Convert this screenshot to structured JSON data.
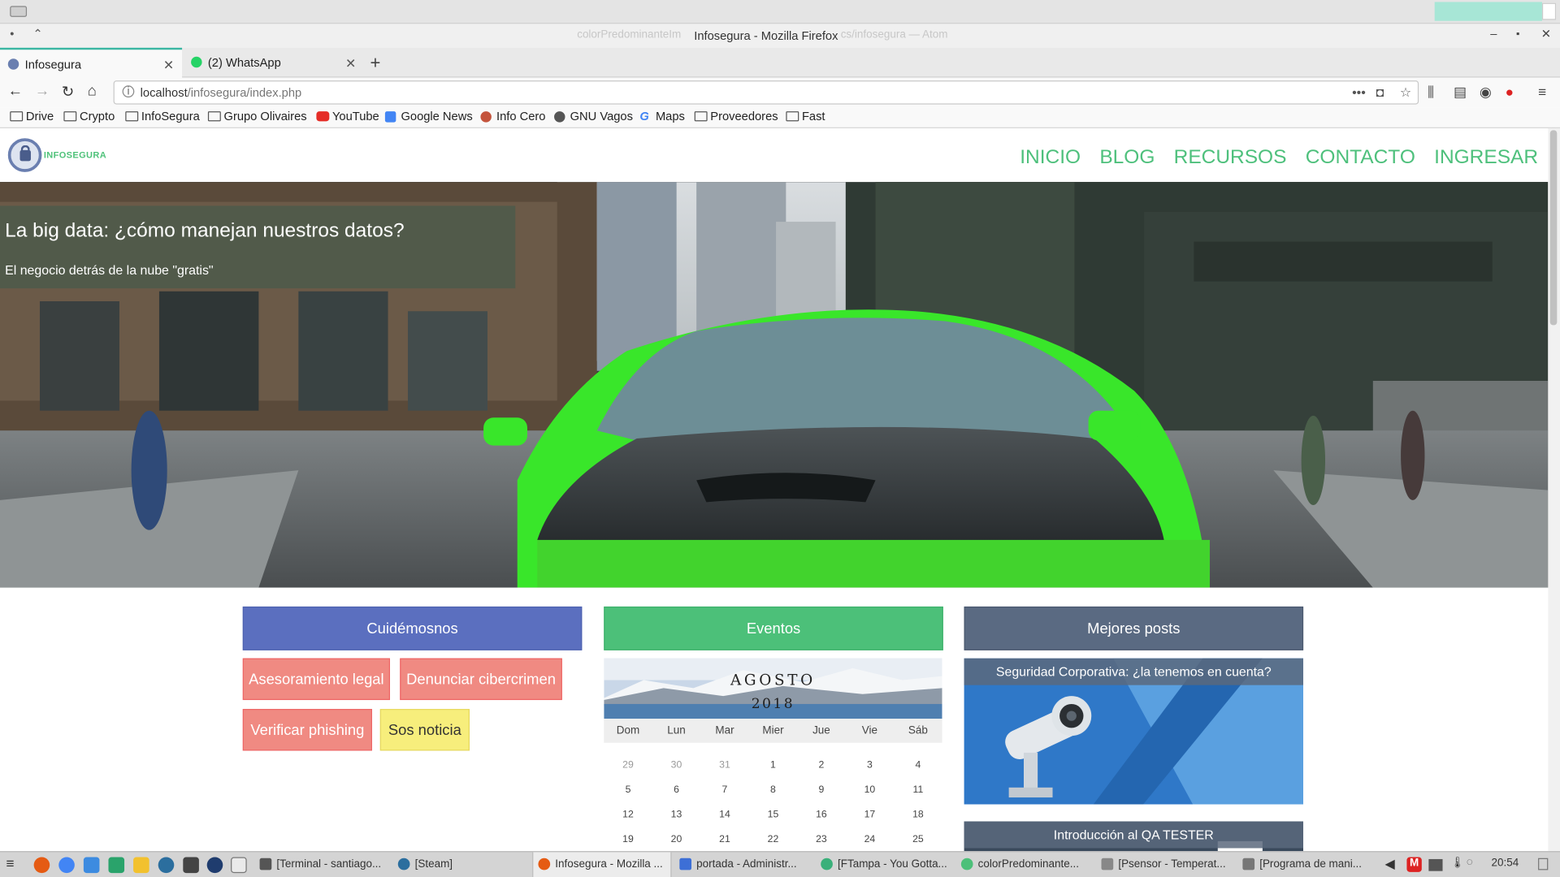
{
  "window": {
    "title": "Infosegura - Mozilla Firefox",
    "ghost_left": "colorPredominanteIm",
    "ghost_right": "cs/infosegura — Atom"
  },
  "tabs": [
    {
      "label": "Infosegura"
    },
    {
      "label": "(2) WhatsApp"
    }
  ],
  "url": {
    "host": "localhost",
    "path": "/infosegura/index.php"
  },
  "bookmarks": [
    "Drive",
    "Crypto",
    "InfoSegura",
    "Grupo Olivaires",
    "YouTube",
    "Google News",
    "Info Cero",
    "GNU Vagos",
    "Maps",
    "Proveedores",
    "Fast"
  ],
  "site": {
    "logo_text": "INFOSEGURA",
    "menu": [
      "INICIO",
      "BLOG",
      "RECURSOS",
      "CONTACTO",
      "INGRESAR"
    ],
    "hero": {
      "title": "La big data: ¿cómo manejan nuestros datos?",
      "subtitle": "El negocio detrás de la nube \"gratis\""
    },
    "col1": {
      "title": "Cuidémosnos",
      "buttons": [
        "Asesoramiento legal",
        "Denunciar cibercrimen",
        "Verificar phishing",
        "Sos noticia"
      ]
    },
    "col2": {
      "title": "Eventos",
      "month": "AGOSTO",
      "year": "2018",
      "days": [
        "Dom",
        "Lun",
        "Mar",
        "Mier",
        "Jue",
        "Vie",
        "Sáb"
      ],
      "weeks": [
        [
          "29",
          "30",
          "31",
          "1",
          "2",
          "3",
          "4"
        ],
        [
          "5",
          "6",
          "7",
          "8",
          "9",
          "10",
          "11"
        ],
        [
          "12",
          "13",
          "14",
          "15",
          "16",
          "17",
          "18"
        ],
        [
          "19",
          "20",
          "21",
          "22",
          "23",
          "24",
          "25"
        ]
      ]
    },
    "col3": {
      "title": "Mejores posts",
      "posts": [
        "Seguridad Corporativa: ¿la tenemos en cuenta?",
        "Introducción al QA TESTER"
      ]
    }
  },
  "taskbar": {
    "items": [
      "[Terminal - santiago...",
      "[Steam]",
      "Infosegura - Mozilla ...",
      "portada - Administr...",
      "[FTampa - You Gotta...",
      "colorPredominante...",
      "[Psensor - Temperat...",
      "[Programa de mani..."
    ],
    "clock": "20:54"
  },
  "colors": {
    "accent": "#4ec07c",
    "blue": "#5b6fbf",
    "green": "#4cc079",
    "slate": "#5a6a82",
    "salmon": "#f08a82",
    "yellow": "#f7ee7c"
  }
}
